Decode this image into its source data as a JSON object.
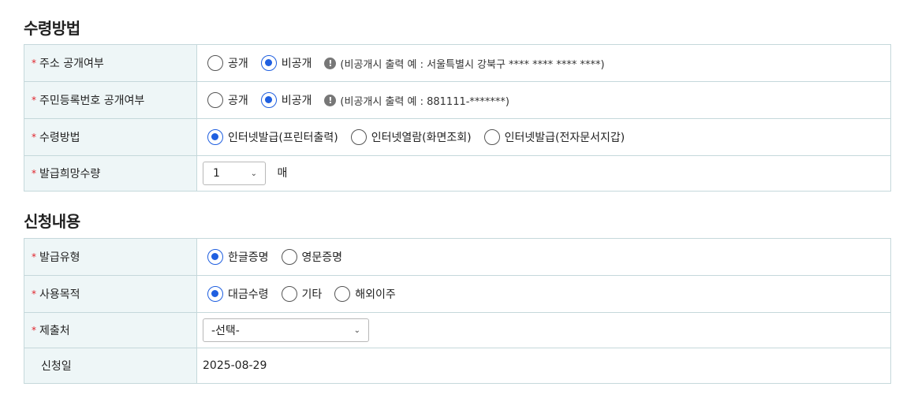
{
  "section1": {
    "title": "수령방법",
    "rows": {
      "address": {
        "label": "주소 공개여부",
        "options": [
          "공개",
          "비공개"
        ],
        "selected": "비공개",
        "hint": "(비공개시 출력 예 : 서울특별시 강북구 **** **** **** ****)"
      },
      "rrn": {
        "label": "주민등록번호 공개여부",
        "options": [
          "공개",
          "비공개"
        ],
        "selected": "비공개",
        "hint": "(비공개시 출력 예 : 881111-*******)"
      },
      "method": {
        "label": "수령방법",
        "options": [
          "인터넷발급(프린터출력)",
          "인터넷열람(화면조회)",
          "인터넷발급(전자문서지갑)"
        ],
        "selected": "인터넷발급(프린터출력)"
      },
      "quantity": {
        "label": "발급희망수량",
        "value": "1",
        "unit": "매"
      }
    }
  },
  "section2": {
    "title": "신청내용",
    "rows": {
      "type": {
        "label": "발급유형",
        "options": [
          "한글증명",
          "영문증명"
        ],
        "selected": "한글증명"
      },
      "purpose": {
        "label": "사용목적",
        "options": [
          "대금수령",
          "기타",
          "해외이주"
        ],
        "selected": "대금수령"
      },
      "destination": {
        "label": "제출처",
        "value": "-선택-"
      },
      "date": {
        "label": "신청일",
        "value": "2025-08-29"
      }
    }
  },
  "required_mark": "*",
  "info_icon_glyph": "!",
  "colors": {
    "accent": "#1f5fe0",
    "required": "#e0232b",
    "header_bg": "#eef6f7",
    "border": "#c5d8db"
  }
}
